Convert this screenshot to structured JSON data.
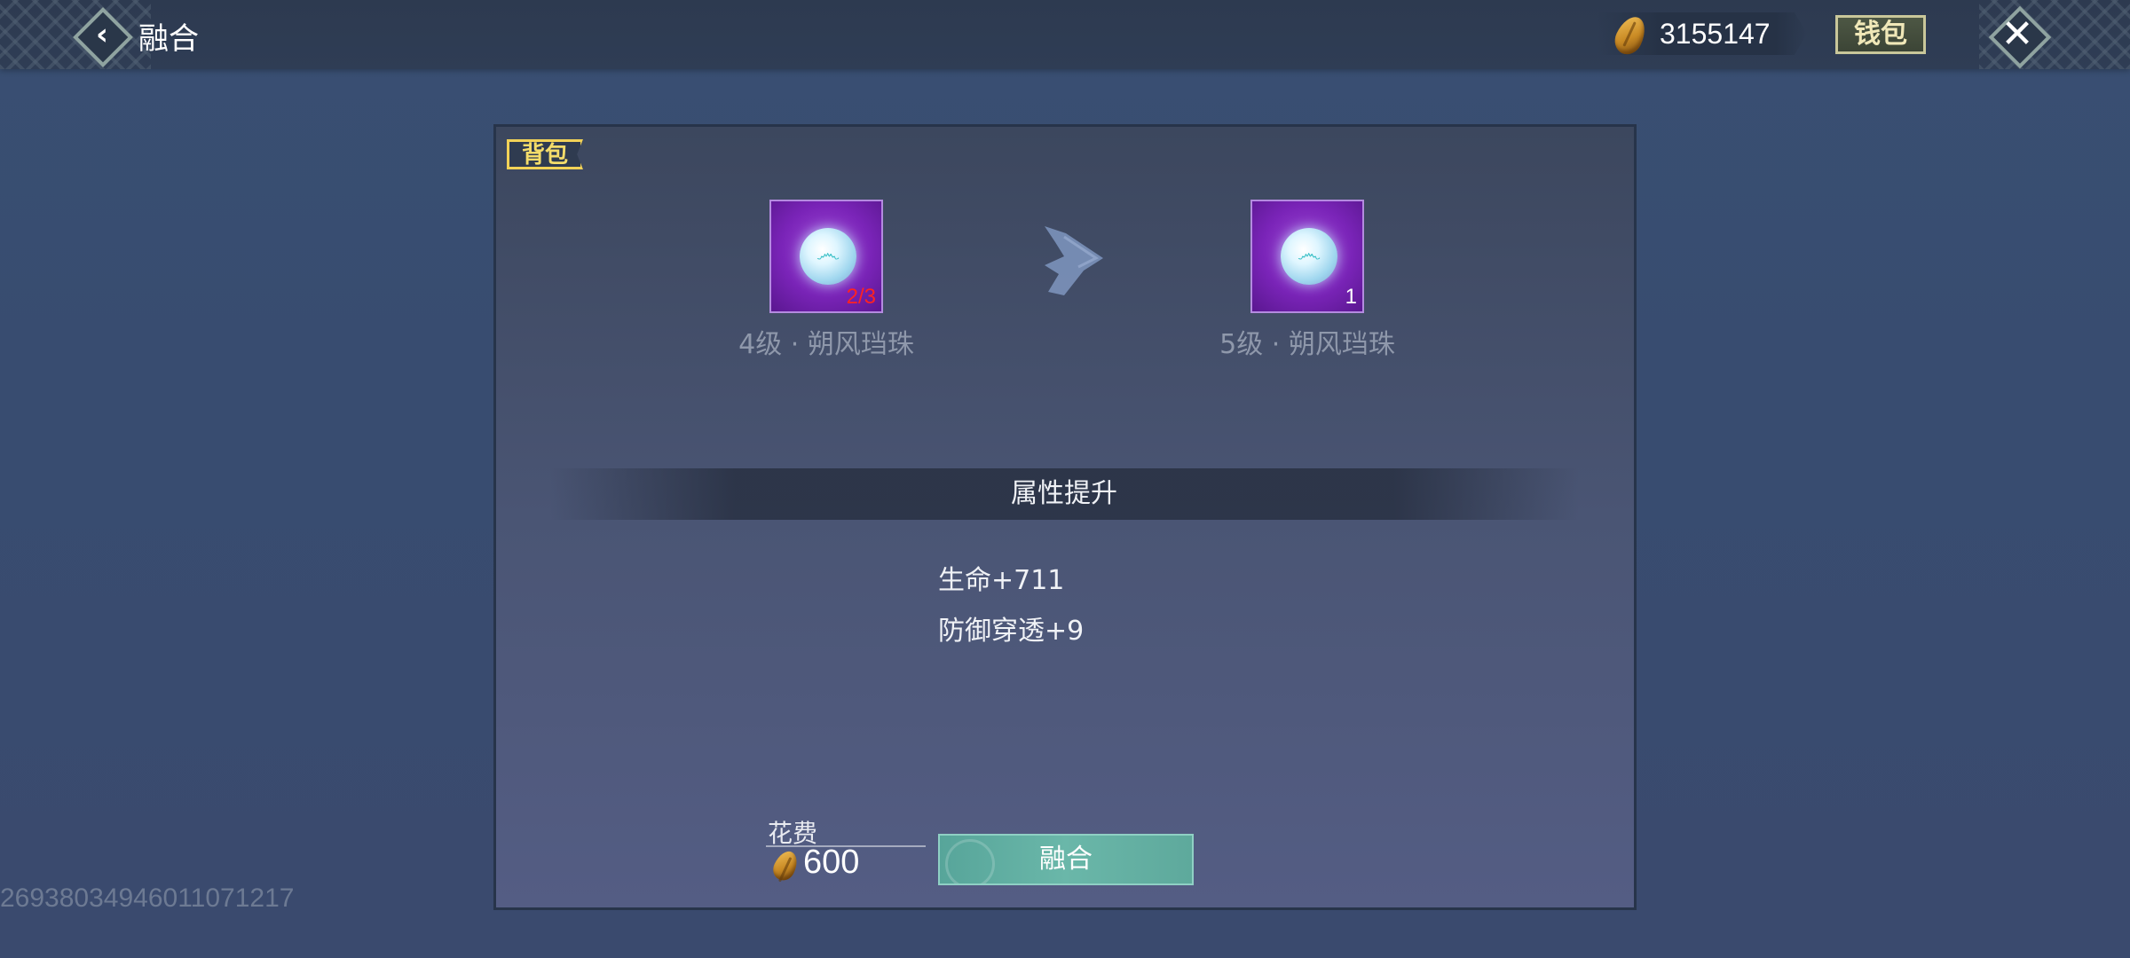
{
  "header": {
    "title": "融合",
    "currency_amount": "3155147",
    "wallet_label": "钱包"
  },
  "panel": {
    "tag_label": "背包",
    "source_item": {
      "name": "4级 · 朔风珰珠",
      "count": "2/3",
      "icon": "wind-pearl-icon"
    },
    "result_item": {
      "name": "5级 · 朔风珰珠",
      "count": "1",
      "icon": "wind-pearl-icon"
    },
    "attributes_title": "属性提升",
    "attributes": [
      "生命+711",
      "防御穿透+9"
    ],
    "cost_label": "花费",
    "cost_amount": "600",
    "fuse_button_label": "融合"
  },
  "watermark": "2693803494601107121​7",
  "colors": {
    "accent_gold": "#f2d257",
    "item_purple": "#7a24b8",
    "fuse_teal": "#62ad9f",
    "insufficient_red": "#ff2222"
  }
}
